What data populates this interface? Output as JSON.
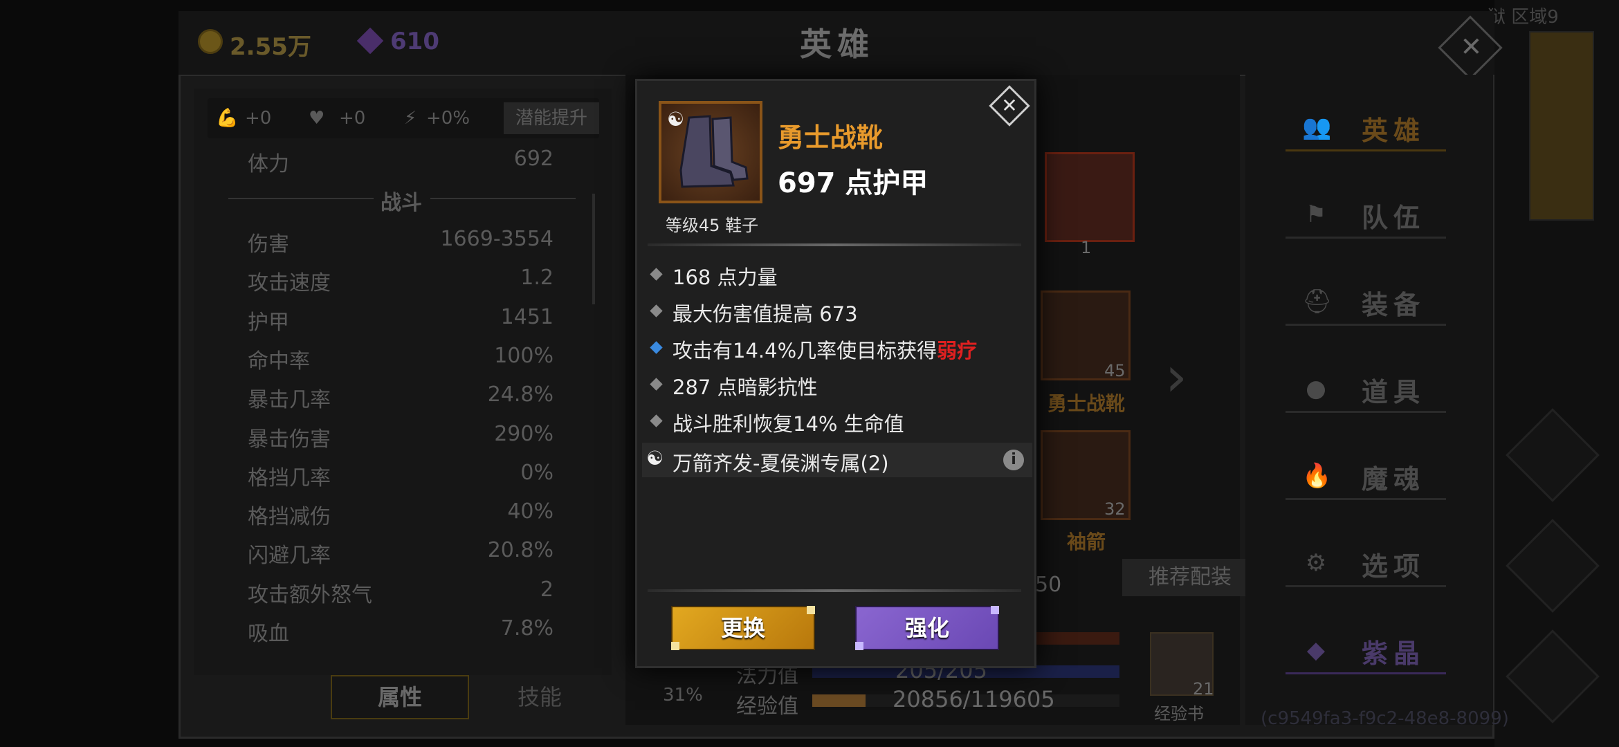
{
  "header": {
    "title": "英雄",
    "gold": "2.55万",
    "gems": "610",
    "zone": "狱 区域9"
  },
  "stats_panel": {
    "potential": [
      {
        "icon": "strength-arm-icon",
        "value": "+0"
      },
      {
        "icon": "heart-icon",
        "value": "+0"
      },
      {
        "icon": "lightning-icon",
        "value": "+0%"
      }
    ],
    "potential_button": "潜能提升",
    "partial_top": {
      "label": "体力",
      "value": "692"
    },
    "section_title": "战斗",
    "stats": [
      {
        "label": "伤害",
        "value": "1669-3554"
      },
      {
        "label": "攻击速度",
        "value": "1.2"
      },
      {
        "label": "护甲",
        "value": "1451"
      },
      {
        "label": "命中率",
        "value": "100%"
      },
      {
        "label": "暴击几率",
        "value": "24.8%"
      },
      {
        "label": "暴击伤害",
        "value": "290%"
      },
      {
        "label": "格挡几率",
        "value": "0%"
      },
      {
        "label": "格挡减伤",
        "value": "40%"
      },
      {
        "label": "闪避几率",
        "value": "20.8%"
      },
      {
        "label": "攻击额外怒气",
        "value": "2"
      },
      {
        "label": "吸血",
        "value": "7.8%"
      }
    ],
    "tabs": {
      "attributes": "属性",
      "skills": "技能"
    }
  },
  "equipment": {
    "slot_top": {
      "count": "1"
    },
    "slot_boots": {
      "level": "45",
      "name": "勇士战靴"
    },
    "slot_sleeve": {
      "level": "32",
      "name": "袖箭"
    },
    "partial_num": "50",
    "recommend_button": "推荐配装",
    "percent": "31%",
    "mana_label": "法力值",
    "mana_value": "205/205",
    "exp_label": "经验值",
    "exp_value": "20856/119605",
    "exp_progress": 0.174,
    "book_label": "经验书",
    "book_count": "21"
  },
  "nav": [
    {
      "icon": "hero-icon",
      "label": "英雄",
      "active": true
    },
    {
      "icon": "flag-icon",
      "label": "队伍"
    },
    {
      "icon": "helmet-icon",
      "label": "装备"
    },
    {
      "icon": "bag-icon",
      "label": "道具"
    },
    {
      "icon": "flame-icon",
      "label": "魔魂"
    },
    {
      "icon": "gear-icon",
      "label": "选项"
    },
    {
      "icon": "crystal-icon",
      "label": "紫晶"
    }
  ],
  "guid": "(c9549fa3-f9c2-48e8-8099)",
  "modal": {
    "item_name": "勇士战靴",
    "item_main": "697 点护甲",
    "item_level": "等级45 鞋子",
    "attributes": [
      {
        "text": "168 点力量",
        "bullet": "gray"
      },
      {
        "text": "最大伤害值提高 673",
        "bullet": "gray"
      },
      {
        "text": "攻击有14.4%几率使目标获得",
        "highlight": "弱疗",
        "bullet": "blue"
      },
      {
        "text": "287 点暗影抗性",
        "bullet": "gray"
      },
      {
        "text": "战斗胜利恢复14% 生命值",
        "bullet": "gray"
      }
    ],
    "set_text": "万箭齐发-夏侯渊专属(2)",
    "buttons": {
      "change": "更换",
      "enhance": "强化"
    },
    "colors": {
      "item_name": "#e89a2c",
      "highlight": "#e02020",
      "change": "#e2a820",
      "enhance": "#8a66d0"
    }
  }
}
